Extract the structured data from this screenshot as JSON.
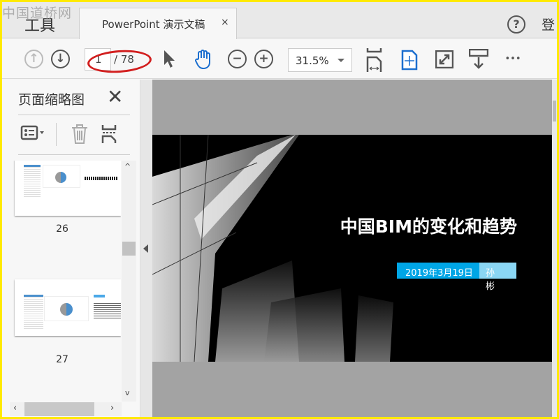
{
  "watermark": "中国道桥网",
  "tabs": {
    "tools": "工具",
    "document": "PowerPoint 演示文稿",
    "close": "×"
  },
  "header": {
    "help": "?",
    "login": "登"
  },
  "toolbar": {
    "current_page": "1",
    "total_pages": "/ 78",
    "zoom": "31.5%",
    "more": "•••"
  },
  "panel": {
    "title": "页面缩略图",
    "close": "✕",
    "thumbnails": [
      {
        "page": "26"
      },
      {
        "page": "27"
      }
    ]
  },
  "slide": {
    "title": "中国BIM的变化和趋势",
    "date": "2019年3月19日",
    "author": "孙 彬",
    "colors": {
      "date_bg": "#00a6e6",
      "author_bg": "#8ad6f4"
    }
  }
}
